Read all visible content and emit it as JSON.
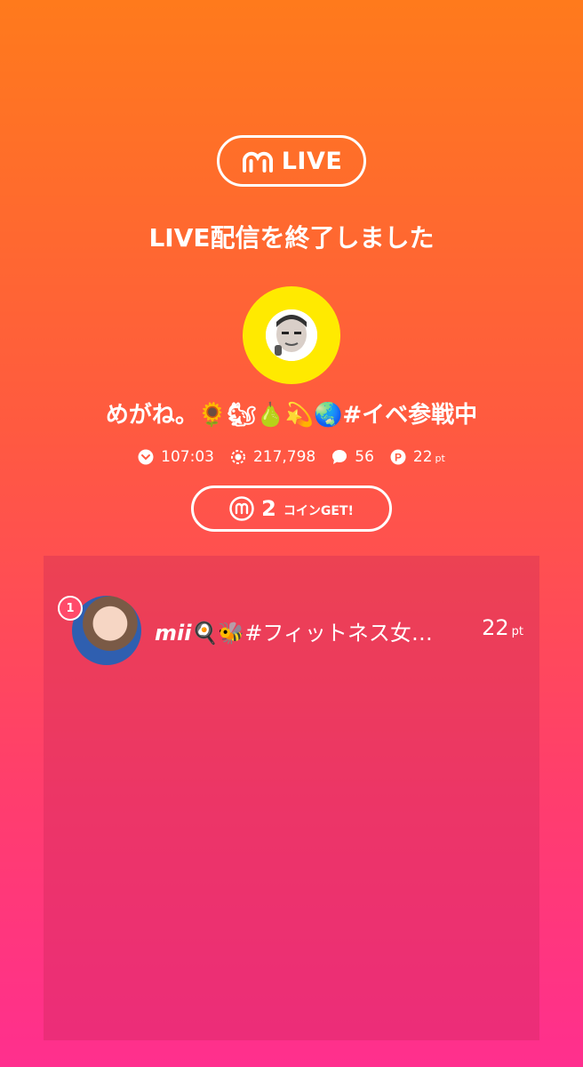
{
  "header": {
    "brand_label": "LIVE",
    "title": "LIVE配信を終了しました"
  },
  "broadcaster": {
    "name": "めがね。🌻🐿🍐💫🌏#イベ参戦中",
    "avatar": "avatar"
  },
  "stats": {
    "duration": "107:03",
    "viewers": "217,798",
    "comments": "56",
    "points": "22",
    "points_unit": "pt"
  },
  "coin": {
    "count": "2",
    "label": "コインGET!"
  },
  "ranking": [
    {
      "rank": "1",
      "name_prefix": "mii",
      "name_rest": "🍳🐝#フィットネス女…",
      "points": "22",
      "unit": "pt"
    }
  ],
  "colors": {
    "gradient_top": "#ff7a1c",
    "gradient_bottom": "#ff2f8e",
    "avatar_ring": "#ffea00",
    "rank_badge": "#ff4b6a"
  }
}
